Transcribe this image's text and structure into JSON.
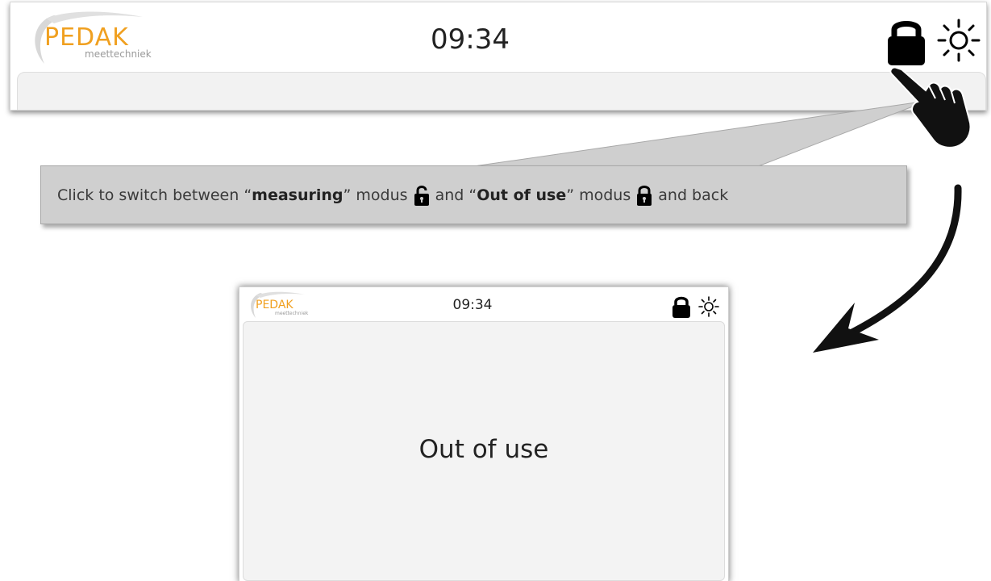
{
  "top_screen": {
    "logo_brand": "PEDAK",
    "logo_sub": "meettechniek",
    "time": "09:34",
    "lock_icon": "lock-closed-icon",
    "brightness_icon": "sun-icon"
  },
  "callout": {
    "part1": "Click to switch between “",
    "measuring": "measuring",
    "part2": "” modus",
    "part3": "and “",
    "out_of_use": "Out of use",
    "part4": "” modus",
    "part5": "and back",
    "open_lock_icon": "lock-open-icon",
    "closed_lock_icon": "lock-closed-icon"
  },
  "device": {
    "logo_brand": "PEDAK",
    "logo_sub": "meettechniek",
    "time": "09:34",
    "status_text": "Out of use",
    "lock_icon": "lock-closed-icon",
    "brightness_icon": "sun-icon"
  },
  "colors": {
    "brand_orange": "#f0a020",
    "callout_bg": "#cfcfcf",
    "panel_bg": "#f3f3f3",
    "text_dark": "#222222"
  }
}
